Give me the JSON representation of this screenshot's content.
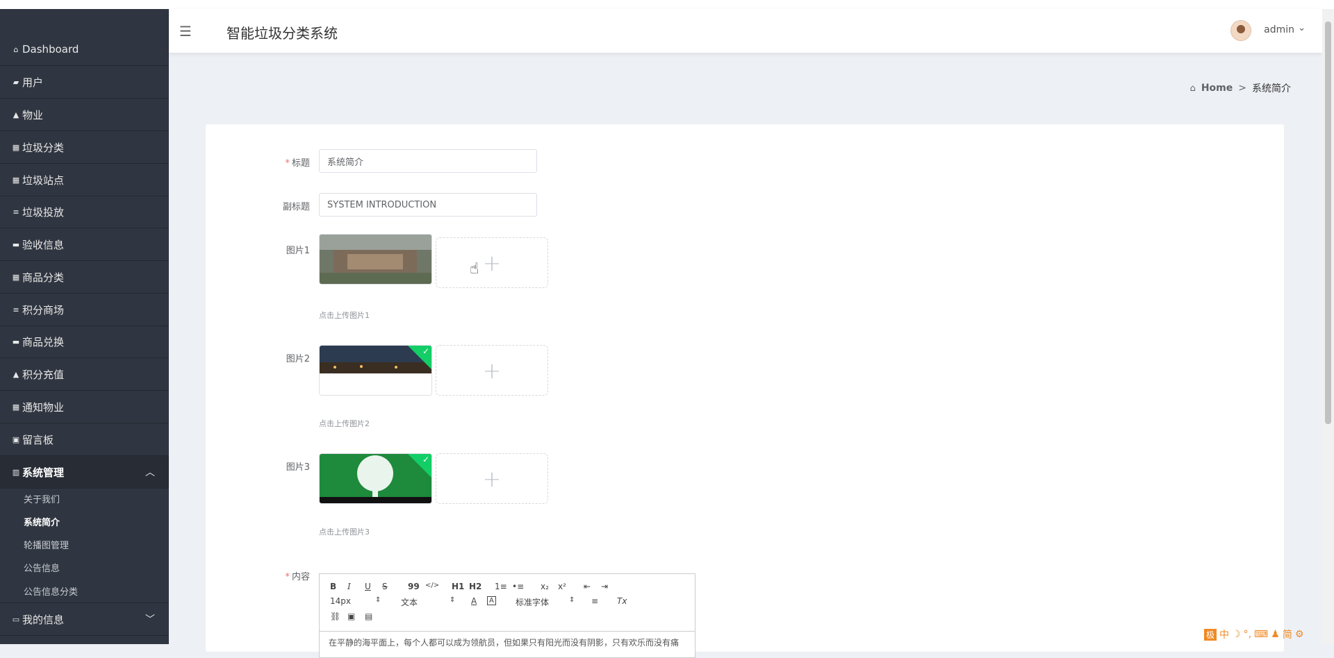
{
  "app": {
    "title": "智能垃圾分类系统",
    "menu_icon": "menu-icon"
  },
  "user": {
    "name": "admin",
    "avatar_icon": "avatar-icon"
  },
  "sidebar": {
    "items": [
      {
        "label": "Dashboard",
        "icon": "⌂"
      },
      {
        "label": "用户",
        "icon": "▰"
      },
      {
        "label": "物业",
        "icon": "▲"
      },
      {
        "label": "垃圾分类",
        "icon": "▦"
      },
      {
        "label": "垃圾站点",
        "icon": "▦"
      },
      {
        "label": "垃圾投放",
        "icon": "≡"
      },
      {
        "label": "验收信息",
        "icon": "▬"
      },
      {
        "label": "商品分类",
        "icon": "▦"
      },
      {
        "label": "积分商场",
        "icon": "≡"
      },
      {
        "label": "商品兑换",
        "icon": "▬"
      },
      {
        "label": "积分充值",
        "icon": "▲"
      },
      {
        "label": "通知物业",
        "icon": "▦"
      },
      {
        "label": "留言板",
        "icon": "▣"
      },
      {
        "label": "系统管理",
        "icon": "▥"
      }
    ],
    "sub_items": [
      "关于我们",
      "系统简介",
      "轮播图管理",
      "公告信息",
      "公告信息分类"
    ],
    "bottom_item": {
      "label": "我的信息",
      "icon": "▭"
    }
  },
  "breadcrumb": {
    "home": "Home",
    "separator": ">",
    "current": "系统简介"
  },
  "form": {
    "title_label": "标题",
    "title_value": "系统简介",
    "subtitle_label": "副标题",
    "subtitle_value": "SYSTEM INTRODUCTION",
    "images": [
      {
        "label": "图片1",
        "hint": "点击上传图片1"
      },
      {
        "label": "图片2",
        "hint": "点击上传图片2"
      },
      {
        "label": "图片3",
        "hint": "点击上传图片3"
      }
    ],
    "content_label": "内容",
    "content_preview": "在平静的海平面上，每个人都可以成为领航员，但如果只有阳光而没有阴影，只有欢乐而没有痛"
  },
  "editor": {
    "buttons_row1": [
      "B",
      "I",
      "U",
      "S",
      "99",
      "</>",
      "H1",
      "H2",
      "1≡",
      "•≡",
      "x₂",
      "x²",
      "⇤",
      "⇥"
    ],
    "font_size": "14px",
    "block_type": "文本",
    "font_family": "标准字体",
    "buttons_row3": [
      "link",
      "image",
      "video"
    ]
  },
  "colors": {
    "sidebar_bg": "#303641",
    "accent_green": "#13ce66",
    "required_red": "#f56c6c",
    "page_bg": "#edf0f4"
  },
  "ime": [
    "极",
    "中",
    "☽",
    "°,",
    "⌨",
    "♟",
    "简",
    "⚙"
  ]
}
